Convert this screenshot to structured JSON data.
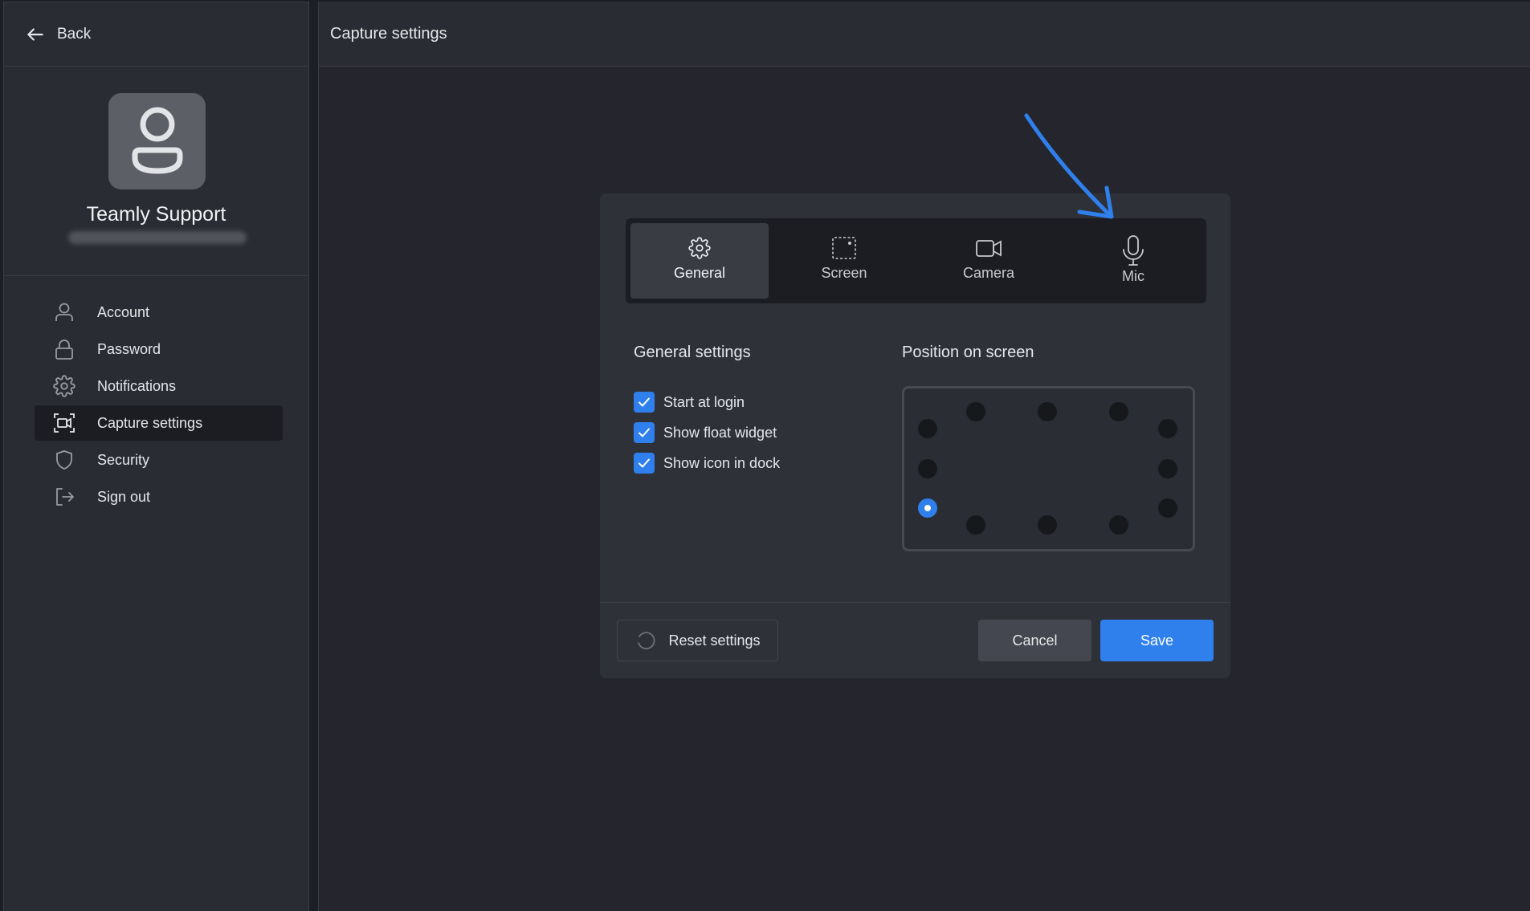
{
  "sidebar": {
    "back_label": "Back",
    "profile_name": "Teamly Support",
    "items": [
      {
        "label": "Account",
        "icon": "user-icon"
      },
      {
        "label": "Password",
        "icon": "lock-icon"
      },
      {
        "label": "Notifications",
        "icon": "gear-icon"
      },
      {
        "label": "Capture settings",
        "icon": "capture-icon",
        "active": true
      },
      {
        "label": "Security",
        "icon": "shield-icon"
      },
      {
        "label": "Sign out",
        "icon": "sign-out-icon"
      }
    ]
  },
  "main": {
    "title": "Capture settings"
  },
  "dialog": {
    "tabs": [
      {
        "label": "General",
        "icon": "gear-icon",
        "active": true
      },
      {
        "label": "Screen",
        "icon": "screen-capture-icon"
      },
      {
        "label": "Camera",
        "icon": "camera-icon"
      },
      {
        "label": "Mic",
        "icon": "microphone-icon"
      }
    ],
    "general_title": "General settings",
    "position_title": "Position on screen",
    "checkboxes": [
      {
        "label": "Start at login",
        "checked": true
      },
      {
        "label": "Show float widget",
        "checked": true
      },
      {
        "label": "Show icon in dock",
        "checked": true
      }
    ],
    "selected_position": "left-bottom",
    "buttons": {
      "reset": "Reset settings",
      "cancel": "Cancel",
      "save": "Save"
    }
  },
  "colors": {
    "accent": "#2f80ed",
    "background": "#1e1f25",
    "panel": "#2f3139"
  }
}
